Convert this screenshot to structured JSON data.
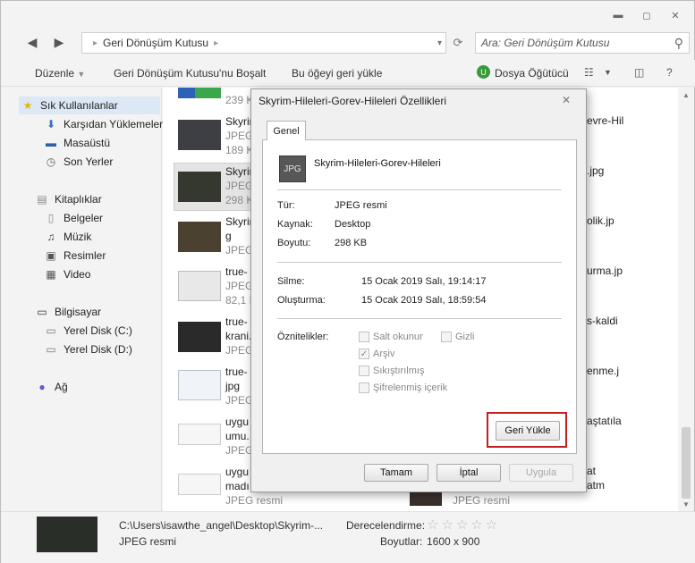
{
  "window": {
    "controls": {
      "minimize": "▬",
      "maximize": "◻",
      "close": "✕"
    }
  },
  "nav": {
    "back": "◀",
    "forward": "▶",
    "address": "Geri Dönüşüm Kutusu",
    "address_sep": "▸",
    "search_placeholder": "Ara: Geri Dönüşüm Kutusu"
  },
  "toolbar": {
    "organize": "Düzenle",
    "empty_bin": "Geri Dönüşüm Kutusu'nu Boşalt",
    "restore_item": "Bu öğeyi geri yükle",
    "download_badge": "U",
    "download_manager": "Dosya Öğütücü"
  },
  "sidebar": {
    "favorites": "Sık Kullanılanlar",
    "downloads": "Karşıdan Yüklemeler",
    "desktop": "Masaüstü",
    "recent": "Son Yerler",
    "libraries": "Kitaplıklar",
    "documents": "Belgeler",
    "music": "Müzik",
    "pictures": "Resimler",
    "videos": "Video",
    "computer": "Bilgisayar",
    "disk_c": "Yerel Disk (C:)",
    "disk_d": "Yerel Disk (D:)",
    "network": "Ağ"
  },
  "files": [
    {
      "name": "",
      "meta": "239 K"
    },
    {
      "name": "Skyrim",
      "meta": "JPEG",
      "meta2": "189 K"
    },
    {
      "name": "Skyrim",
      "meta": "JPEG",
      "meta2": "298 K"
    },
    {
      "name": "Skyrim",
      "name2": "g",
      "meta": "JPEG"
    },
    {
      "name": "true-",
      "meta": "JPEG",
      "meta2": "82,1 K"
    },
    {
      "name": "true-",
      "name2": "krani.",
      "meta": "JPEG"
    },
    {
      "name": "true-",
      "name2": "jpg",
      "meta": "JPEG"
    },
    {
      "name": "uygu",
      "name2": "umu.",
      "meta": "JPEG"
    },
    {
      "name": "uygu",
      "name2": "madı",
      "meta": "JPEG resmi"
    }
  ],
  "right_col": [
    "evre-Hil",
    ".jpg",
    "olik.jp",
    "urma.jp",
    "s-kaldi",
    "enme.j",
    "aştatıla",
    "at",
    "atm",
    "JPEG resmi"
  ],
  "status": {
    "path": "C:\\Users\\isawthe_angel\\Desktop\\Skyrim-...",
    "type": "JPEG resmi",
    "rating_label": "Derecelendirme:",
    "stars": "☆☆☆☆☆",
    "size_label": "Boyutlar:",
    "size_value": "1600 x 900"
  },
  "dialog": {
    "title": "Skyrim-Hileleri-Gorev-Hileleri Özellikleri",
    "close": "✕",
    "tab": "Genel",
    "icon_label": "JPG",
    "filename": "Skyrim-Hileleri-Gorev-Hileleri",
    "props": {
      "type_label": "Tür:",
      "type_value": "JPEG resmi",
      "source_label": "Kaynak:",
      "source_value": "Desktop",
      "size_label": "Boyutu:",
      "size_value": "298 KB",
      "deleted_label": "Silme:",
      "deleted_value": "15 Ocak 2019 Salı, 19:14:17",
      "created_label": "Oluşturma:",
      "created_value": "15 Ocak 2019 Salı, 18:59:54",
      "attributes_label": "Öznitelikler:"
    },
    "attributes": {
      "readonly": "Salt okunur",
      "hidden": "Gizli",
      "archive": "Arşiv",
      "compressed": "Sıkıştırılmış",
      "encrypted": "Şifrelenmiş içerik",
      "archive_checked": "✓"
    },
    "restore": "Geri Yükle",
    "ok": "Tamam",
    "cancel": "İptal",
    "apply": "Uygula"
  }
}
